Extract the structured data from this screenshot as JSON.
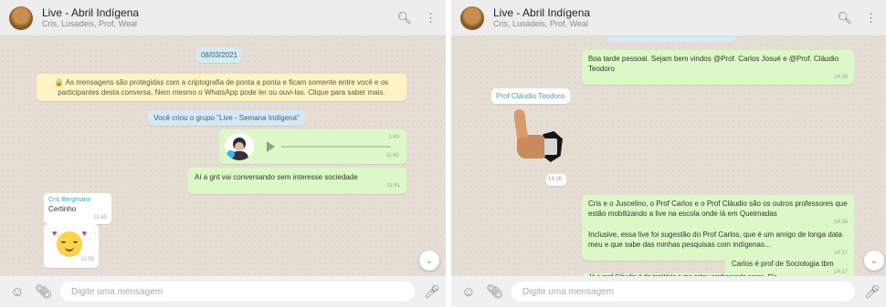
{
  "left": {
    "header": {
      "title": "Live - Abril Indígena",
      "subtitle": "Cris, Lusadeis, Prof, Weal"
    },
    "date_chip": "08/03/2021",
    "encryption_notice": "🔒 As mensagens são protegidas com a criptografia de ponta a ponta e ficam somente entre você e os participantes desta conversa. Nem mesmo o WhatsApp pode ler ou ouvi-las. Clique para saber mais.",
    "created_notice": "Você criou o grupo \"Live - Semana Indígena\"",
    "audio_time": "1:40",
    "audio_stamp": "11:41",
    "msg1": {
      "text": "Aí a gnt vai conversando sem interesse sociedade",
      "time": "11:41"
    },
    "msg2": {
      "sender": "Cris Bergmann",
      "text": "Certinho",
      "time": "11:45"
    },
    "sticker_time": "11:55",
    "composer_placeholder": "Digite uma mensagem"
  },
  "right": {
    "header": {
      "title": "Live - Abril Indígena",
      "subtitle": "Cris, Lusadeis, Prof, Weal"
    },
    "welcome": {
      "text": "Boa tarde pessoal. Sejam bem vindos @Prof. Carlos Josué e @Prof. Cláudio Teodoro",
      "time": "14:16"
    },
    "prof_chip": "Prof Cláudio Teodoro",
    "thumb_time": "14:16",
    "msg_intro": {
      "text": "Cris e o Juscelino, o Prof Carlos e o Prof Cláudio são os outros professores que estão mobilizando a live na escola onde lá em Queimadas",
      "time": "14:16"
    },
    "msg_inclusive": {
      "text": "Inclusive, essa live foi sugestão do Prof Carlos, que é um amigo de longa data meu e que sabe das minhas pesquisas com indígenas...",
      "time": "14:17"
    },
    "msg_carlos": {
      "text": "Carlos é prof de Sociologia tbm",
      "time": "14:17"
    },
    "msg_cut": "Já o prof Cláudio é do território e me estou conhecendo agora. Ele...",
    "composer_placeholder": "Digite uma mensagem"
  },
  "colors": {
    "header_bg": "#ededed",
    "chat_bg": "#e6ded5",
    "outgoing": "#dcf8c6",
    "incoming": "#ffffff",
    "system": "#d4eaf4",
    "notice": "#fdf3c5"
  }
}
